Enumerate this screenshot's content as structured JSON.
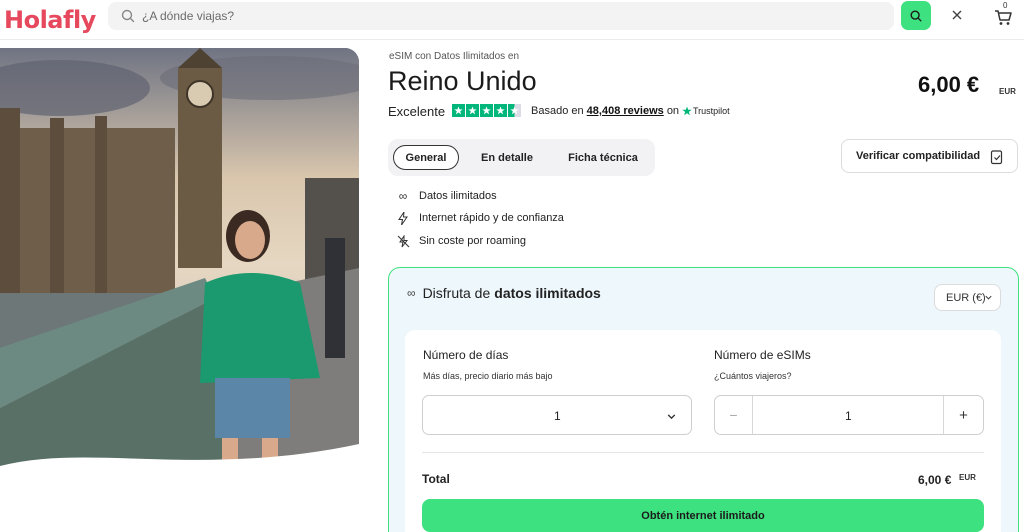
{
  "header": {
    "logo": "Holafly",
    "search_placeholder": "¿A dónde viajas?",
    "cart_count": "0"
  },
  "product": {
    "subtitle": "eSIM con Datos Ilimitados en",
    "title": "Reino Unido",
    "price": "6,00 €",
    "price_currency": "EUR"
  },
  "rating": {
    "label": "Excelente",
    "stars": 4.5,
    "based_prefix": "Basado en",
    "reviews_link": "48,408 reviews",
    "on": "on",
    "provider": "Trustpilot"
  },
  "tabs": [
    {
      "label": "General",
      "active": true
    },
    {
      "label": "En detalle",
      "active": false
    },
    {
      "label": "Ficha técnica",
      "active": false
    }
  ],
  "verify_label": "Verificar compatibilidad",
  "features": [
    {
      "icon": "infinity-icon",
      "text": "Datos ilimitados"
    },
    {
      "icon": "lightning-icon",
      "text": "Internet rápido y de confianza"
    },
    {
      "icon": "no-roaming-icon",
      "text": "Sin coste por roaming"
    }
  ],
  "plan": {
    "heading_prefix": "Disfruta de",
    "heading_bold": "datos ilimitados",
    "currency_select": "EUR (€)",
    "days_label": "Número de días",
    "days_hint": "Más días, precio diario más bajo",
    "days_value": "1",
    "sims_label": "Número de eSIMs",
    "sims_hint": "¿Cuántos viajeros?",
    "sims_value": "1",
    "minus": "−",
    "plus": "+",
    "total_label": "Total",
    "total_value": "6,00 €",
    "total_currency": "EUR",
    "cta_label": "Obtén internet ilimitado"
  },
  "colors": {
    "brand": "#e6485d",
    "accent_green": "#3ee17f",
    "trustpilot_green": "#00b67a"
  }
}
